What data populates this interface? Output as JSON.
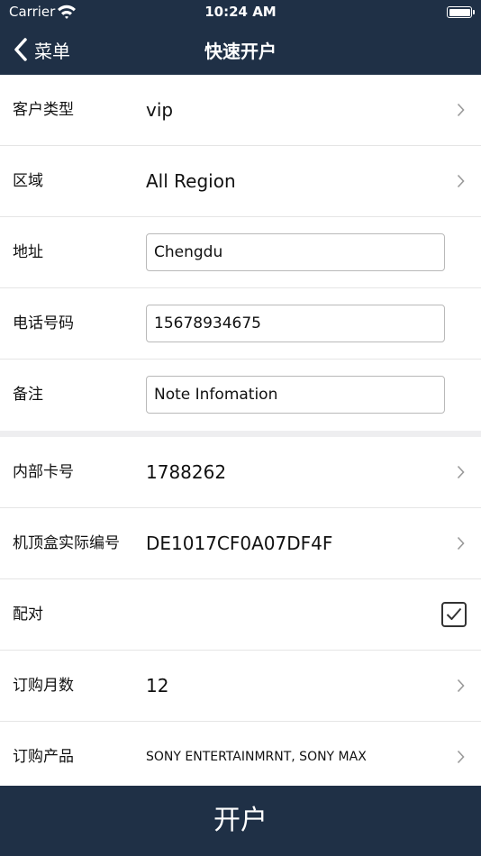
{
  "status_bar": {
    "carrier": "Carrier",
    "time": "10:24 AM"
  },
  "nav": {
    "back_label": "菜单",
    "title": "快速开户"
  },
  "form": {
    "customer_type": {
      "label": "客户类型",
      "value": "vip"
    },
    "region": {
      "label": "区域",
      "value": "All Region"
    },
    "address": {
      "label": "地址",
      "value": "Chengdu"
    },
    "phone": {
      "label": "电话号码",
      "value": "15678934675"
    },
    "note": {
      "label": "备注",
      "value": "Note Infomation"
    },
    "card_number": {
      "label": "内部卡号",
      "value": "1788262"
    },
    "stb_number": {
      "label": "机顶盒实际编号",
      "value": "DE1017CF0A07DF4F"
    },
    "pairing": {
      "label": "配对",
      "checked": true
    },
    "months": {
      "label": "订购月数",
      "value": "12"
    },
    "products": {
      "label": "订购产品",
      "value": "SONY ENTERTAINMRNT, SONY MAX"
    }
  },
  "submit_label": "开户",
  "colors": {
    "header_bg": "#1f3046",
    "section_gap": "#eeeef0"
  }
}
